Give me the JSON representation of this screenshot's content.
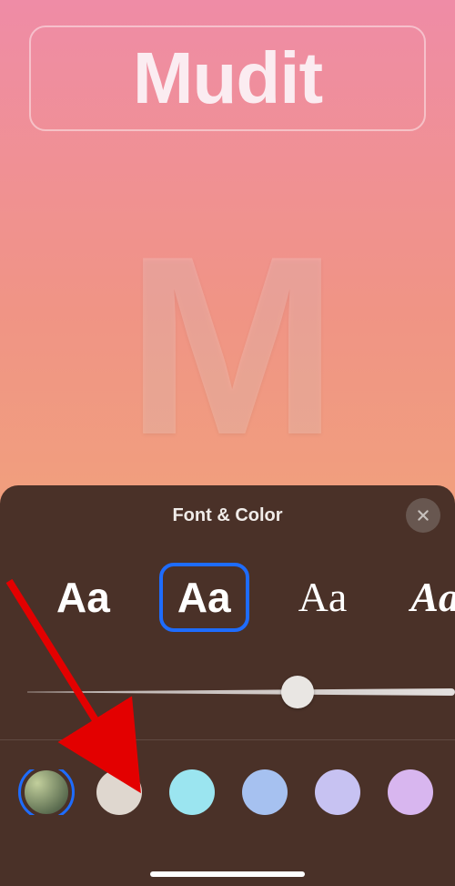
{
  "contact": {
    "name": "Mudit",
    "monogram": "M"
  },
  "sheet": {
    "title": "Font & Color",
    "font_samples": [
      "Aa",
      "Aa",
      "Aa",
      "Aa"
    ],
    "selected_font_index": 1,
    "slider_value": 0.67,
    "colors": [
      "#7a8a5e",
      "#dfd7cf",
      "#9be5f0",
      "#a6c1f0",
      "#c7c2f2",
      "#d8b6ef",
      "#f0b0cc"
    ],
    "selected_color_index": 0
  }
}
